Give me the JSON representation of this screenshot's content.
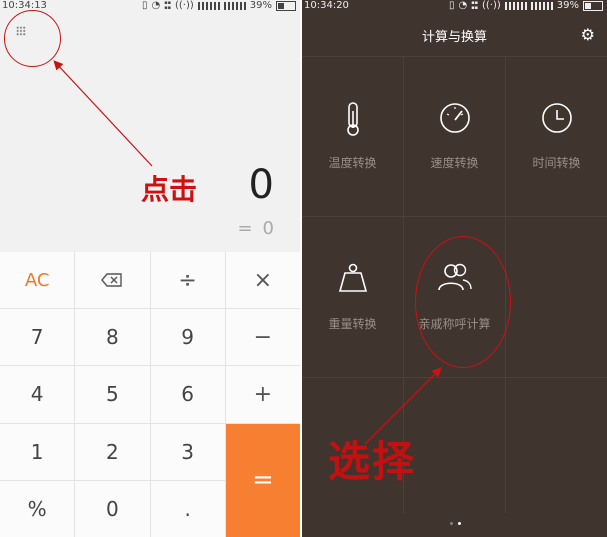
{
  "left": {
    "status": {
      "time": "10:34:13",
      "battery": "39%"
    },
    "display": {
      "value": "0",
      "equals_sign": "=",
      "result": "0"
    },
    "annotation": "点击",
    "keys": [
      {
        "label": "AC",
        "name": "key-clear"
      },
      {
        "label": "⌫",
        "name": "key-backspace"
      },
      {
        "label": "÷",
        "name": "key-divide"
      },
      {
        "label": "×",
        "name": "key-multiply"
      },
      {
        "label": "7",
        "name": "key-7"
      },
      {
        "label": "8",
        "name": "key-8"
      },
      {
        "label": "9",
        "name": "key-9"
      },
      {
        "label": "−",
        "name": "key-minus"
      },
      {
        "label": "4",
        "name": "key-4"
      },
      {
        "label": "5",
        "name": "key-5"
      },
      {
        "label": "6",
        "name": "key-6"
      },
      {
        "label": "+",
        "name": "key-plus"
      },
      {
        "label": "1",
        "name": "key-1"
      },
      {
        "label": "2",
        "name": "key-2"
      },
      {
        "label": "3",
        "name": "key-3"
      },
      {
        "label": "=",
        "name": "key-equals"
      },
      {
        "label": "%",
        "name": "key-percent"
      },
      {
        "label": "0",
        "name": "key-0"
      },
      {
        "label": ".",
        "name": "key-decimal"
      }
    ]
  },
  "right": {
    "status": {
      "time": "10:34:20",
      "battery": "39%"
    },
    "title": "计算与换算",
    "settings_icon": "gear-icon",
    "tiles": [
      {
        "label": "温度转换",
        "icon": "thermometer-icon"
      },
      {
        "label": "速度转换",
        "icon": "speedometer-icon"
      },
      {
        "label": "时间转换",
        "icon": "clock-icon"
      },
      {
        "label": "重量转换",
        "icon": "weight-icon"
      },
      {
        "label": "亲戚称呼计算",
        "icon": "people-icon"
      }
    ],
    "annotation": "选择"
  },
  "colors": {
    "accent_orange": "#f77f32",
    "annotation_red": "#cc1111",
    "dark_bg": "#40342f"
  }
}
